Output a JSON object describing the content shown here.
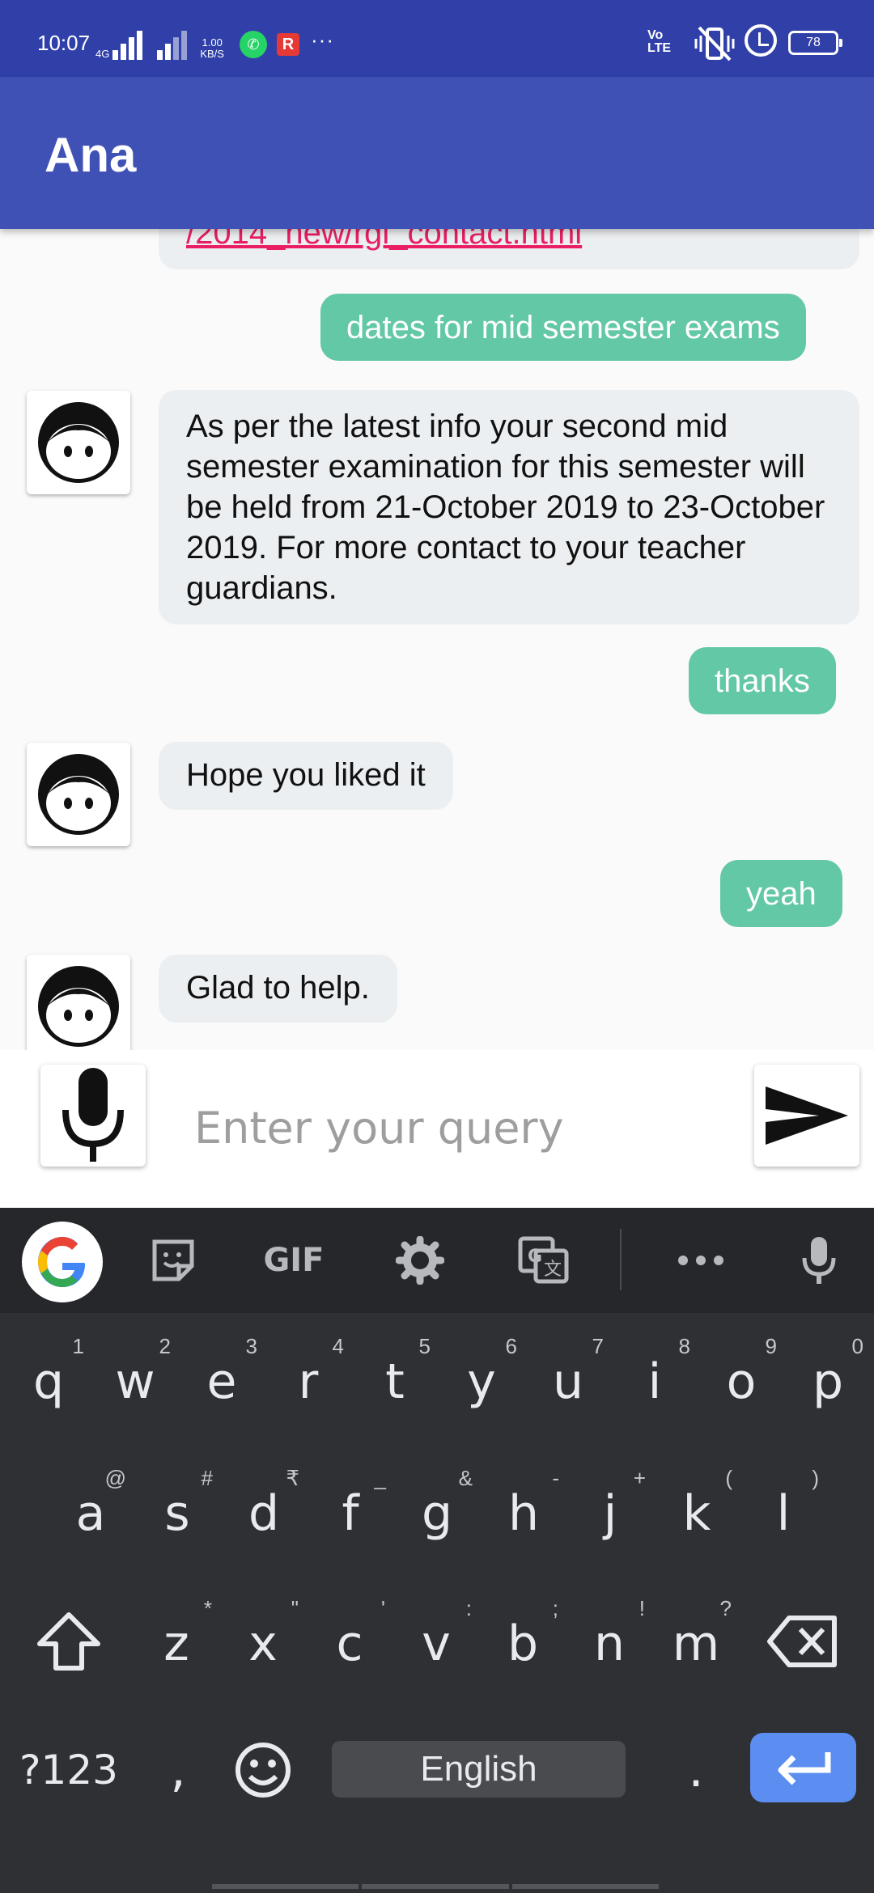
{
  "status_bar": {
    "time": "10:07",
    "net_type": "4G",
    "speed_value": "1.00",
    "speed_unit": "KB/S",
    "app_icons": [
      "whatsapp-icon",
      "r-app-icon"
    ],
    "more": "···",
    "volte_top": "Vo",
    "volte_bottom": "LTE",
    "battery": "78"
  },
  "app_bar": {
    "title": "Ana"
  },
  "chat": {
    "messages": [
      {
        "from": "bot",
        "text": "/2014_new/rgi_contact.html",
        "is_link": true
      },
      {
        "from": "user",
        "text": "dates for mid semester exams"
      },
      {
        "from": "bot",
        "text": "As per the latest info your second mid semester examination for this semester will be held from 21-October 2019 to 23-October 2019. For more contact to your teacher guardians."
      },
      {
        "from": "user",
        "text": "thanks"
      },
      {
        "from": "bot",
        "text": "Hope you liked it"
      },
      {
        "from": "user",
        "text": "yeah"
      },
      {
        "from": "bot",
        "text": "Glad to help."
      }
    ]
  },
  "input": {
    "placeholder": "Enter your query",
    "value": ""
  },
  "keyboard": {
    "toolbar": {
      "gif": "GIF"
    },
    "row1": [
      {
        "key": "q",
        "hint": "1"
      },
      {
        "key": "w",
        "hint": "2"
      },
      {
        "key": "e",
        "hint": "3"
      },
      {
        "key": "r",
        "hint": "4"
      },
      {
        "key": "t",
        "hint": "5"
      },
      {
        "key": "y",
        "hint": "6"
      },
      {
        "key": "u",
        "hint": "7"
      },
      {
        "key": "i",
        "hint": "8"
      },
      {
        "key": "o",
        "hint": "9"
      },
      {
        "key": "p",
        "hint": "0"
      }
    ],
    "row2": [
      {
        "key": "a",
        "hint": "@"
      },
      {
        "key": "s",
        "hint": "#"
      },
      {
        "key": "d",
        "hint": "₹"
      },
      {
        "key": "f",
        "hint": "_"
      },
      {
        "key": "g",
        "hint": "&"
      },
      {
        "key": "h",
        "hint": "-"
      },
      {
        "key": "j",
        "hint": "+"
      },
      {
        "key": "k",
        "hint": "("
      },
      {
        "key": "l",
        "hint": ")"
      }
    ],
    "row3": [
      {
        "key": "z",
        "hint": "*"
      },
      {
        "key": "x",
        "hint": "\""
      },
      {
        "key": "c",
        "hint": "'"
      },
      {
        "key": "v",
        "hint": ":"
      },
      {
        "key": "b",
        "hint": ";"
      },
      {
        "key": "n",
        "hint": "!"
      },
      {
        "key": "m",
        "hint": "?"
      }
    ],
    "symbols": "?123",
    "comma": ",",
    "period": ".",
    "space": "English"
  }
}
